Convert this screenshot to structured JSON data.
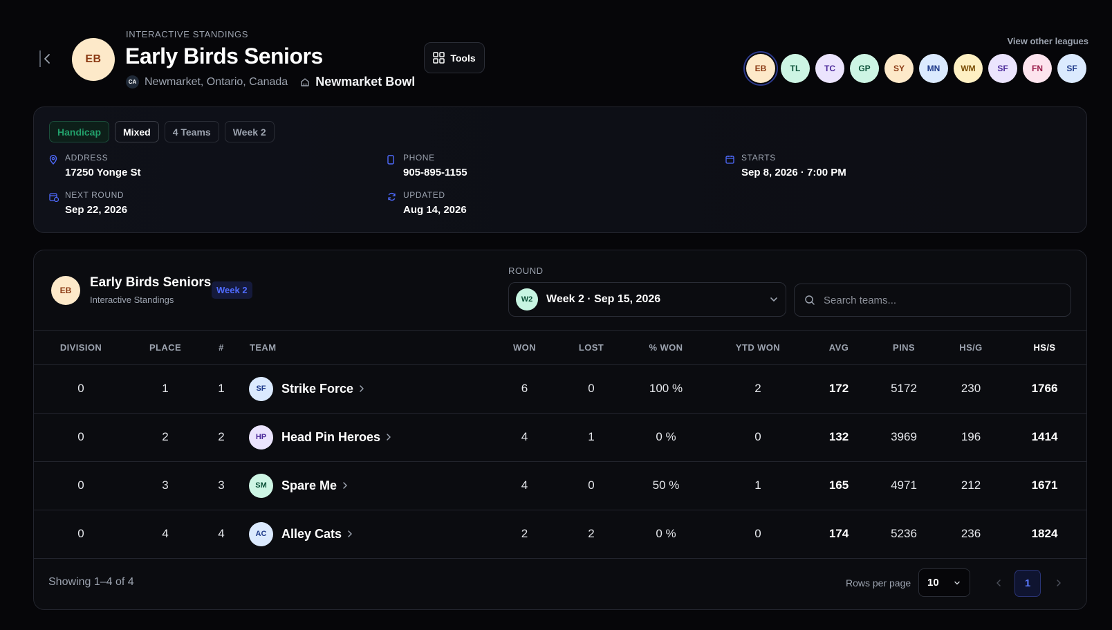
{
  "header": {
    "eyebrow": "INTERACTIVE STANDINGS",
    "title": "Early Birds Seniors",
    "avatar_initials": "EB",
    "country_code": "CA",
    "location": "Newmarket, Ontario, Canada",
    "venue": "Newmarket Bowl",
    "tools_label": "Tools",
    "view_other_label": "View other leagues"
  },
  "leagues": [
    {
      "initials": "EB",
      "bg": "#fde9c9",
      "fg": "#8b3a14",
      "active": true
    },
    {
      "initials": "TL",
      "bg": "#cdf5e4",
      "fg": "#0b5138"
    },
    {
      "initials": "TC",
      "bg": "#ebe4fd",
      "fg": "#4c2a9a"
    },
    {
      "initials": "GP",
      "bg": "#cdf5e4",
      "fg": "#0b5138"
    },
    {
      "initials": "SY",
      "bg": "#fde9c9",
      "fg": "#8b3a14"
    },
    {
      "initials": "MN",
      "bg": "#dbeafe",
      "fg": "#1e3a8a"
    },
    {
      "initials": "WM",
      "bg": "#fef0c3",
      "fg": "#7a4d05"
    },
    {
      "initials": "SF",
      "bg": "#ebe4fd",
      "fg": "#4c2a9a"
    },
    {
      "initials": "FN",
      "bg": "#fde4ee",
      "fg": "#9a1c4a"
    },
    {
      "initials": "SF",
      "bg": "#dbeafe",
      "fg": "#1e3a8a"
    }
  ],
  "tags": [
    "Handicap",
    "Mixed",
    "4 Teams",
    "Week 2"
  ],
  "info": {
    "address_label": "ADDRESS",
    "address": "17250 Yonge St",
    "phone_label": "PHONE",
    "phone": "905-895-1155",
    "starts_label": "STARTS",
    "starts": "Sep 8, 2026 · 7:00 PM",
    "next_round_label": "NEXT ROUND",
    "next_round": "Sep 22, 2026",
    "updated_label": "UPDATED",
    "updated": "Aug 14, 2026"
  },
  "standings": {
    "title": "Early Birds Seniors",
    "subtitle": "Interactive Standings",
    "avatar_initials": "EB",
    "week_badge": "Week 2",
    "round_label": "ROUND",
    "round_badge": "W2",
    "round_value": "Week 2 · Sep 15, 2026",
    "search_placeholder": "Search teams...",
    "columns": [
      "DIVISION",
      "PLACE",
      "#",
      "TEAM",
      "WON",
      "LOST",
      "% WON",
      "YTD WON",
      "AVG",
      "PINS",
      "HS/G",
      "HS/S"
    ],
    "rows": [
      {
        "division": "0",
        "place": "1",
        "num": "1",
        "initials": "SF",
        "team": "Strike Force",
        "won": "6",
        "lost": "0",
        "pct_won": "100 %",
        "ytd_won": "2",
        "avg": "172",
        "pins": "5172",
        "hsg": "230",
        "hss": "1766"
      },
      {
        "division": "0",
        "place": "2",
        "num": "2",
        "initials": "HP",
        "team": "Head Pin Heroes",
        "won": "4",
        "lost": "1",
        "pct_won": "0 %",
        "ytd_won": "0",
        "avg": "132",
        "pins": "3969",
        "hsg": "196",
        "hss": "1414"
      },
      {
        "division": "0",
        "place": "3",
        "num": "3",
        "initials": "SM",
        "team": "Spare Me",
        "won": "4",
        "lost": "0",
        "pct_won": "50 %",
        "ytd_won": "1",
        "avg": "165",
        "pins": "4971",
        "hsg": "212",
        "hss": "1671"
      },
      {
        "division": "0",
        "place": "4",
        "num": "4",
        "initials": "AC",
        "team": "Alley Cats",
        "won": "2",
        "lost": "2",
        "pct_won": "0 %",
        "ytd_won": "0",
        "avg": "174",
        "pins": "5236",
        "hsg": "236",
        "hss": "1824"
      }
    ],
    "showing_text": "Showing 1–4 of 4",
    "rows_per_page_label": "Rows per page",
    "rows_per_page": "10",
    "current_page": "1"
  },
  "colors": {
    "accent_blue": "#4f6bff",
    "green": "#22a06b",
    "team_avatars": [
      "#dbeafe",
      "#ebe4fd",
      "#cdf5e4",
      "#dbeafe"
    ],
    "team_avatar_text": [
      "#1e3a8a",
      "#4c2a9a",
      "#0b5138",
      "#1e3a8a"
    ]
  }
}
